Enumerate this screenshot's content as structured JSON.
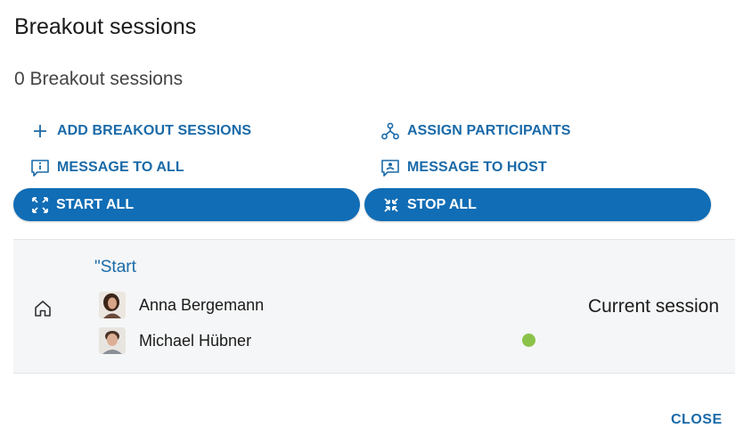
{
  "dialog": {
    "title": "Breakout sessions",
    "count_text": "0 Breakout sessions",
    "close_label": "CLOSE"
  },
  "actions": {
    "add_sessions": "ADD BREAKOUT SESSIONS",
    "assign_participants": "ASSIGN PARTICIPANTS",
    "message_all": "MESSAGE TO ALL",
    "message_host": "MESSAGE TO HOST",
    "start_all": "START ALL",
    "stop_all": "STOP ALL"
  },
  "session": {
    "name": "\"Start",
    "status_label": "Current session",
    "status_color": "#8bc34a",
    "participants": [
      {
        "name": "Anna Bergemann"
      },
      {
        "name": "Michael Hübner"
      }
    ]
  },
  "colors": {
    "accent": "#116db5",
    "link": "#1a6aa8",
    "panel": "#f5f6f7"
  }
}
